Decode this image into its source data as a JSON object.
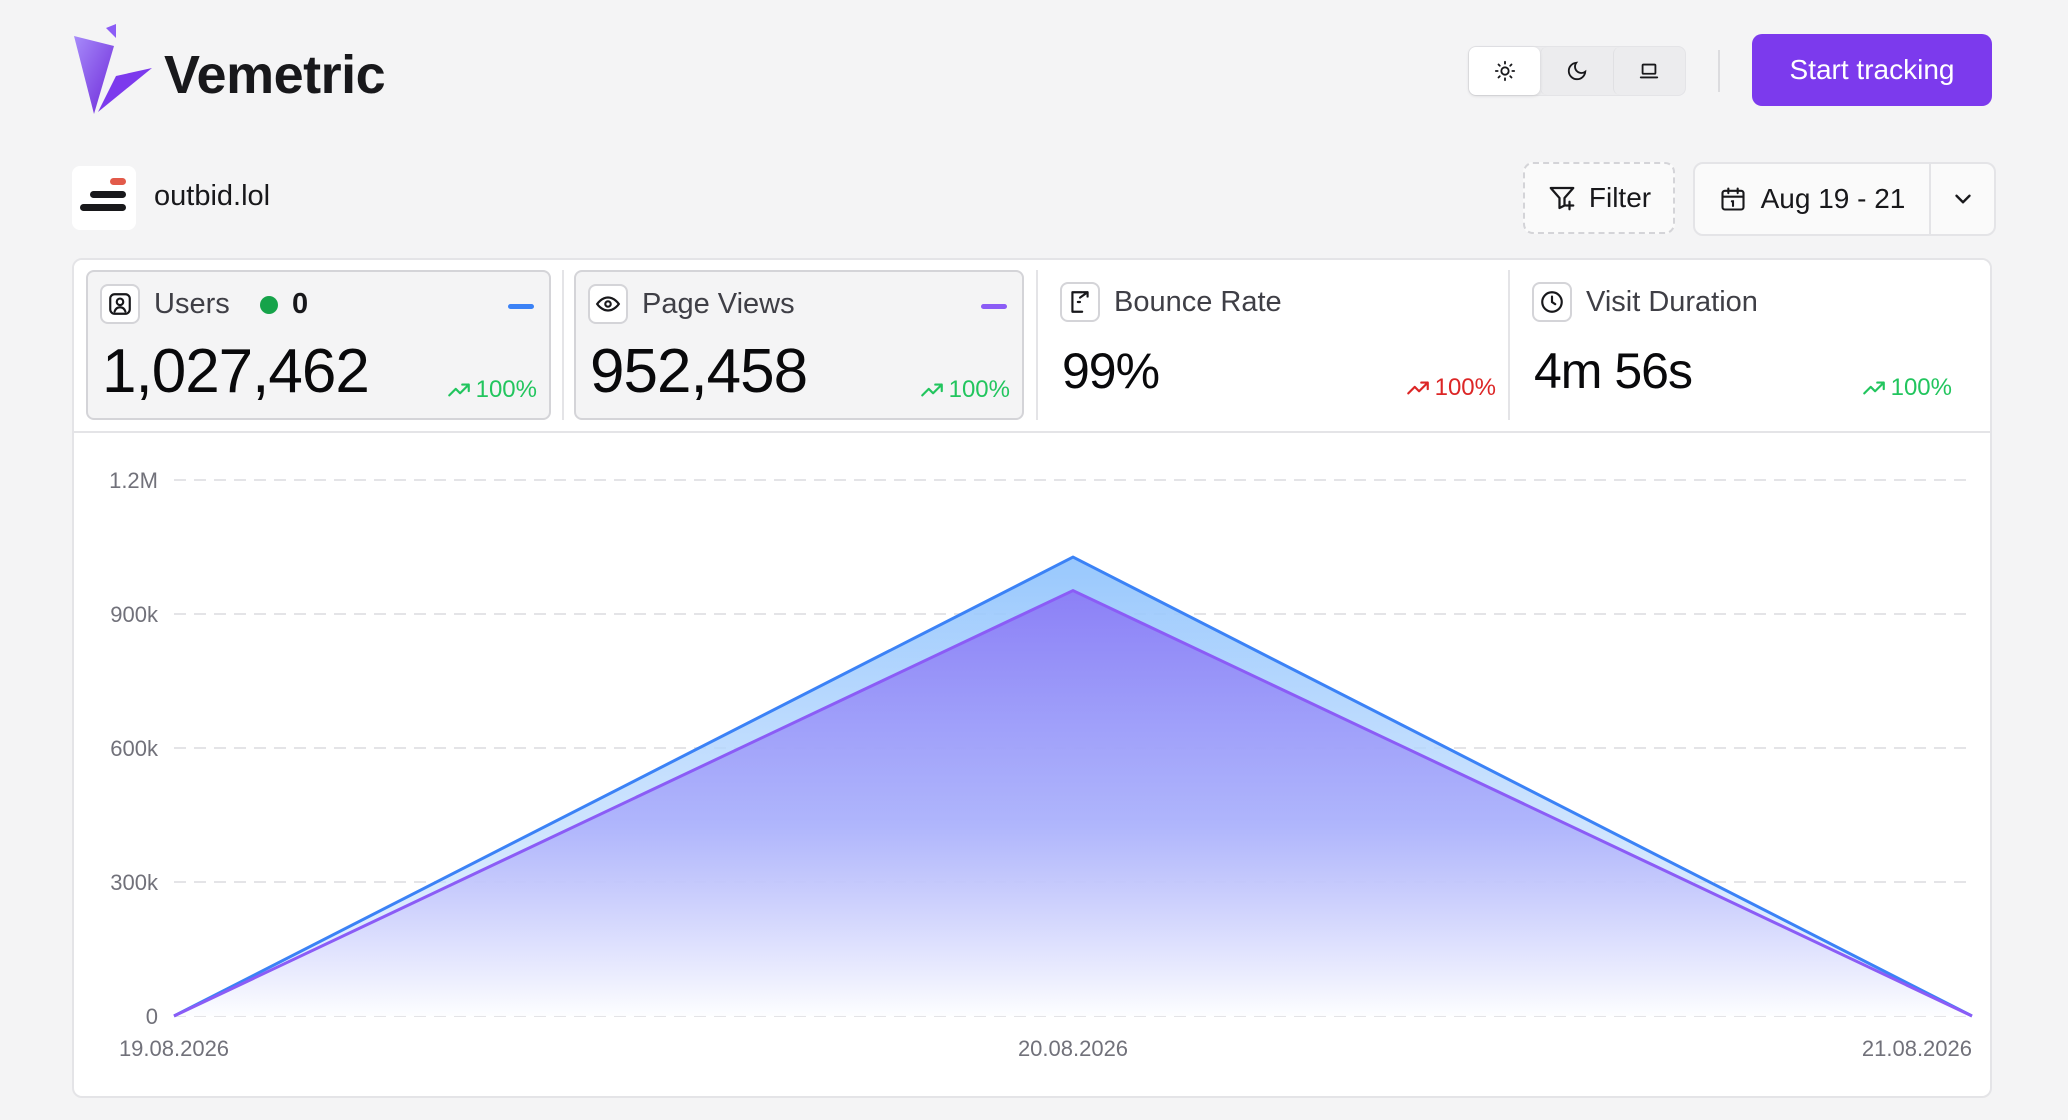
{
  "header": {
    "brand": "Vemetric",
    "start_button": "Start tracking",
    "theme_options": [
      {
        "icon": "sun-icon",
        "active": true
      },
      {
        "icon": "moon-icon",
        "active": false
      },
      {
        "icon": "laptop-icon",
        "active": false
      }
    ]
  },
  "site": {
    "name": "outbid.lol",
    "filter_label": "Filter",
    "date_range": "Aug 19 - 21"
  },
  "stats": {
    "users": {
      "label": "Users",
      "live_count": "0",
      "value": "1,027,462",
      "trend": "100%",
      "icon": "user-icon"
    },
    "page_views": {
      "label": "Page Views",
      "value": "952,458",
      "trend": "100%",
      "icon": "eye-icon"
    },
    "bounce_rate": {
      "label": "Bounce Rate",
      "value": "99%",
      "trend": "100%",
      "icon": "exit-icon"
    },
    "visit_duration": {
      "label": "Visit Duration",
      "value": "4m 56s",
      "trend": "100%",
      "icon": "clock-icon"
    }
  },
  "colors": {
    "accent": "#7c3aed",
    "users_line": "#3b82f6",
    "page_views_line": "#8b5cf6",
    "trend_up": "#22c55e",
    "trend_bad": "#dc2626",
    "live_dot": "#16a34a"
  },
  "chart_data": {
    "type": "area",
    "x": [
      "19.08.2026",
      "20.08.2026",
      "21.08.2026"
    ],
    "series": [
      {
        "key": "users",
        "values": [
          0,
          1027462,
          0
        ],
        "color": "#3b82f6"
      },
      {
        "key": "page_views",
        "values": [
          0,
          952458,
          0
        ],
        "color": "#8b5cf6"
      }
    ],
    "ylim": [
      0,
      1200000
    ],
    "yticks": [
      0,
      300000,
      600000,
      900000,
      1200000
    ],
    "ytick_labels": [
      "0",
      "300k",
      "600k",
      "900k",
      "1.2M"
    ],
    "grid": true
  }
}
